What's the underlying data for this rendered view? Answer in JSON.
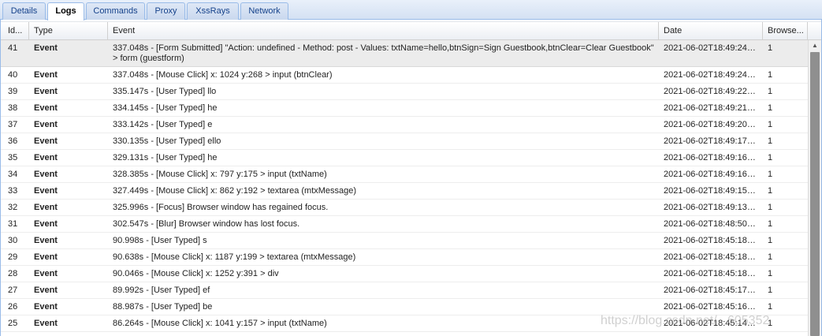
{
  "tabs": [
    {
      "label": "Details",
      "active": false
    },
    {
      "label": "Logs",
      "active": true
    },
    {
      "label": "Commands",
      "active": false
    },
    {
      "label": "Proxy",
      "active": false
    },
    {
      "label": "XssRays",
      "active": false
    },
    {
      "label": "Network",
      "active": false
    }
  ],
  "columns": {
    "id": "Id...",
    "type": "Type",
    "event": "Event",
    "date": "Date",
    "browser": "Browse..."
  },
  "rows": [
    {
      "id": "41",
      "type": "Event",
      "event": "337.048s - [Form Submitted] \"Action: undefined - Method: post - Values: txtName=hello,btnSign=Sign Guestbook,btnClear=Clear Guestbook\" > form (guestform)",
      "date": "2021-06-02T18:49:24+...",
      "browser": "1"
    },
    {
      "id": "40",
      "type": "Event",
      "event": "337.048s - [Mouse Click] x: 1024 y:268 > input (btnClear)",
      "date": "2021-06-02T18:49:24+...",
      "browser": "1"
    },
    {
      "id": "39",
      "type": "Event",
      "event": "335.147s - [User Typed] llo",
      "date": "2021-06-02T18:49:22+...",
      "browser": "1"
    },
    {
      "id": "38",
      "type": "Event",
      "event": "334.145s - [User Typed] he",
      "date": "2021-06-02T18:49:21+...",
      "browser": "1"
    },
    {
      "id": "37",
      "type": "Event",
      "event": "333.142s - [User Typed] e",
      "date": "2021-06-02T18:49:20+...",
      "browser": "1"
    },
    {
      "id": "36",
      "type": "Event",
      "event": "330.135s - [User Typed] ello",
      "date": "2021-06-02T18:49:17+...",
      "browser": "1"
    },
    {
      "id": "35",
      "type": "Event",
      "event": "329.131s - [User Typed] he",
      "date": "2021-06-02T18:49:16+...",
      "browser": "1"
    },
    {
      "id": "34",
      "type": "Event",
      "event": "328.385s - [Mouse Click] x: 797 y:175 > input (txtName)",
      "date": "2021-06-02T18:49:16+...",
      "browser": "1"
    },
    {
      "id": "33",
      "type": "Event",
      "event": "327.449s - [Mouse Click] x: 862 y:192 > textarea (mtxMessage)",
      "date": "2021-06-02T18:49:15+...",
      "browser": "1"
    },
    {
      "id": "32",
      "type": "Event",
      "event": "325.996s - [Focus] Browser window has regained focus.",
      "date": "2021-06-02T18:49:13+...",
      "browser": "1"
    },
    {
      "id": "31",
      "type": "Event",
      "event": "302.547s - [Blur] Browser window has lost focus.",
      "date": "2021-06-02T18:48:50+...",
      "browser": "1"
    },
    {
      "id": "30",
      "type": "Event",
      "event": "90.998s - [User Typed] s",
      "date": "2021-06-02T18:45:18+...",
      "browser": "1"
    },
    {
      "id": "29",
      "type": "Event",
      "event": "90.638s - [Mouse Click] x: 1187 y:199 > textarea (mtxMessage)",
      "date": "2021-06-02T18:45:18+...",
      "browser": "1"
    },
    {
      "id": "28",
      "type": "Event",
      "event": "90.046s - [Mouse Click] x: 1252 y:391 > div",
      "date": "2021-06-02T18:45:18+...",
      "browser": "1"
    },
    {
      "id": "27",
      "type": "Event",
      "event": "89.992s - [User Typed] ef",
      "date": "2021-06-02T18:45:17+...",
      "browser": "1"
    },
    {
      "id": "26",
      "type": "Event",
      "event": "88.987s - [User Typed] be",
      "date": "2021-06-02T18:45:16+...",
      "browser": "1"
    },
    {
      "id": "25",
      "type": "Event",
      "event": "86.264s - [Mouse Click] x: 1041 y:157 > input (txtName)",
      "date": "2021-06-02T18:45:14+...",
      "browser": "1"
    }
  ],
  "watermark": "https://blog.csdn.net/...605352",
  "colors": {
    "tab_border": "#99bbe8",
    "tab_text": "#15428b",
    "selected_row": "#ececec",
    "scroll_thumb": "#8f8f8f"
  }
}
